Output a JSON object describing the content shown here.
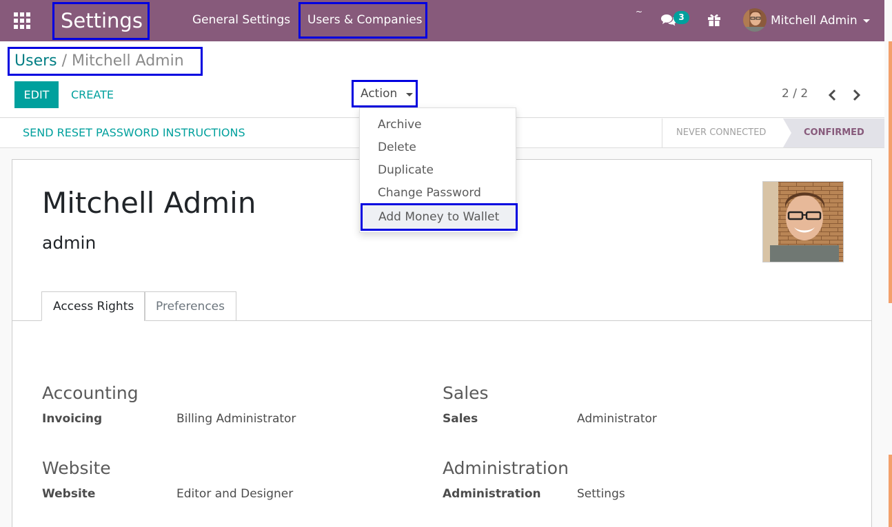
{
  "navbar": {
    "app_title": "Settings",
    "menu": [
      "General Settings",
      "Users & Companies"
    ],
    "tilde": "~",
    "chat_count": "3",
    "user_name": "Mitchell Admin",
    "color": "#875a7b"
  },
  "breadcrumb": {
    "parent": "Users",
    "separator": "/",
    "current": "Mitchell Admin"
  },
  "toolbar": {
    "edit_label": "EDIT",
    "create_label": "CREATE",
    "action_label": "Action",
    "pager": "2 / 2"
  },
  "statusbar": {
    "reset_label": "SEND RESET PASSWORD INSTRUCTIONS",
    "stages": [
      "NEVER CONNECTED",
      "CONFIRMED"
    ],
    "active_stage": "CONFIRMED"
  },
  "action_menu": {
    "items": [
      "Archive",
      "Delete",
      "Duplicate",
      "Change Password",
      "Add Money to Wallet"
    ],
    "highlighted": "Add Money to Wallet"
  },
  "user": {
    "name": "Mitchell Admin",
    "login": "admin"
  },
  "tabs": [
    "Access Rights",
    "Preferences"
  ],
  "access_rights": {
    "accounting": {
      "title": "Accounting",
      "label": "Invoicing",
      "value": "Billing Administrator"
    },
    "sales": {
      "title": "Sales",
      "label": "Sales",
      "value": "Administrator"
    },
    "website": {
      "title": "Website",
      "label": "Website",
      "value": "Editor and Designer"
    },
    "administration": {
      "title": "Administration",
      "label": "Administration",
      "value": "Settings"
    }
  },
  "colors": {
    "accent": "#00a09d",
    "highlight_border": "#0000e0"
  }
}
